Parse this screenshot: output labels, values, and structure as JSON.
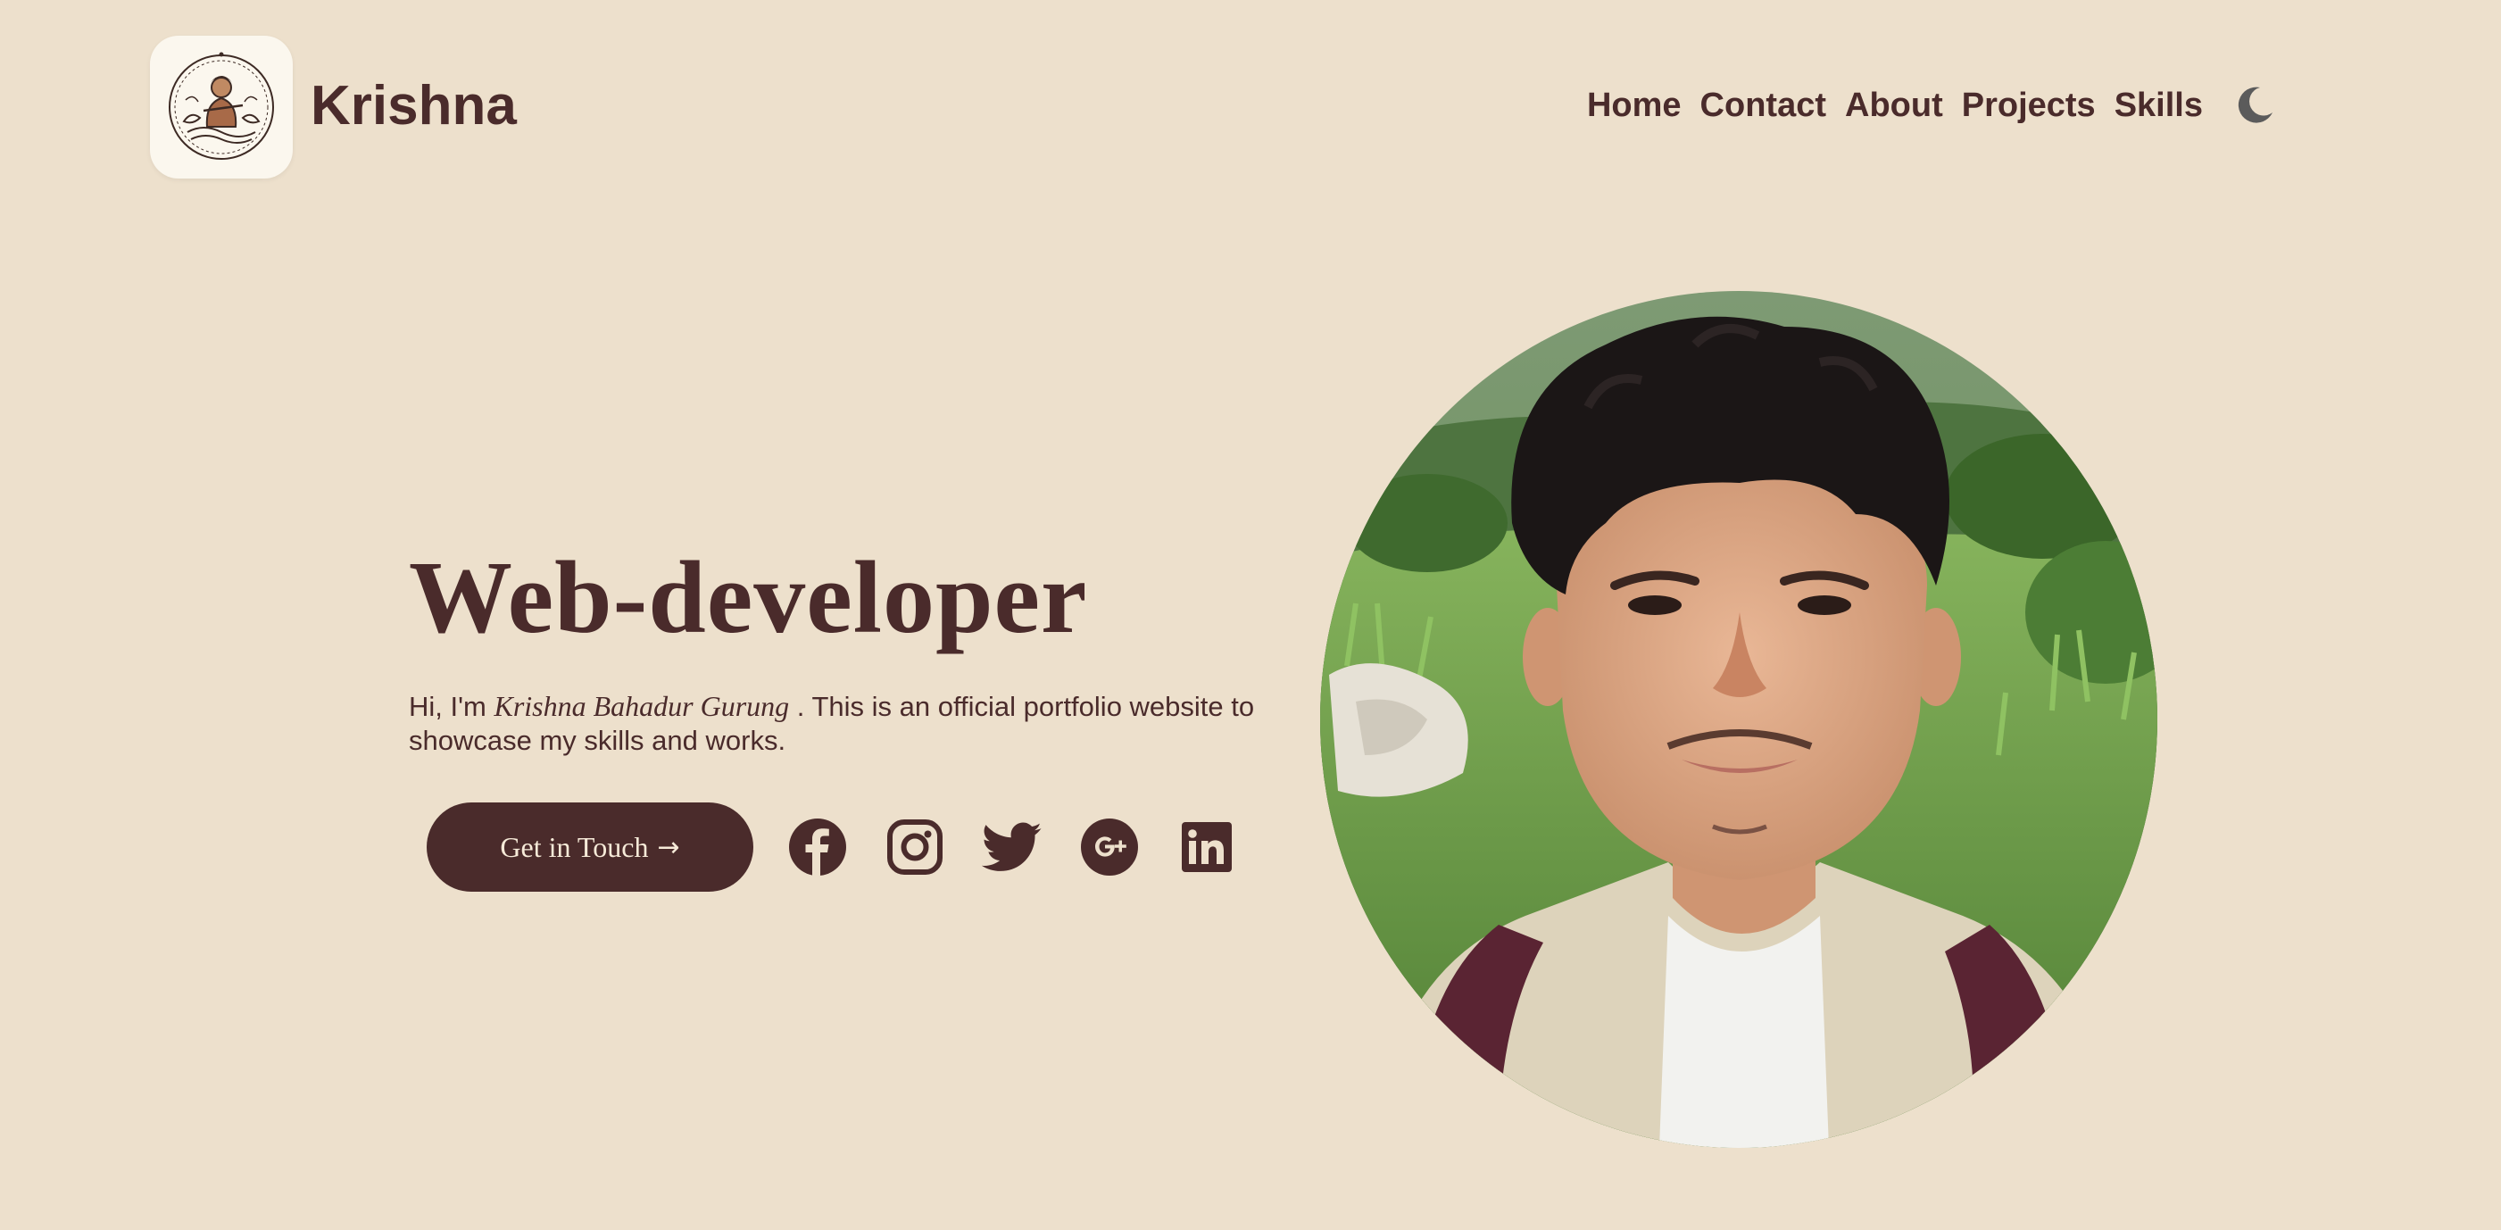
{
  "header": {
    "brand": "Krishna",
    "logo_icon": "krishna-emblem-logo",
    "nav": [
      {
        "label": "Home"
      },
      {
        "label": "Contact"
      },
      {
        "label": "About"
      },
      {
        "label": "Projects"
      },
      {
        "label": "Skills"
      }
    ],
    "theme_toggle_icon": "moon-icon"
  },
  "hero": {
    "title": "Web-developer",
    "intro_prefix": "Hi, I'm ",
    "intro_name": "Krishna Bahadur Gurung",
    "intro_suffix": " . This is an official portfolio website to showcase my skills and works.",
    "cta_label": "Get in Touch",
    "cta_arrow": "→",
    "socials": [
      {
        "icon": "facebook-icon"
      },
      {
        "icon": "instagram-icon"
      },
      {
        "icon": "twitter-icon"
      },
      {
        "icon": "google-plus-icon"
      },
      {
        "icon": "linkedin-icon"
      }
    ],
    "portrait": "profile-photo"
  },
  "colors": {
    "background": "#ede0cc",
    "primary": "#4a2b2b",
    "button_text": "#f6ead8",
    "toggle": "#5b5b5b"
  }
}
